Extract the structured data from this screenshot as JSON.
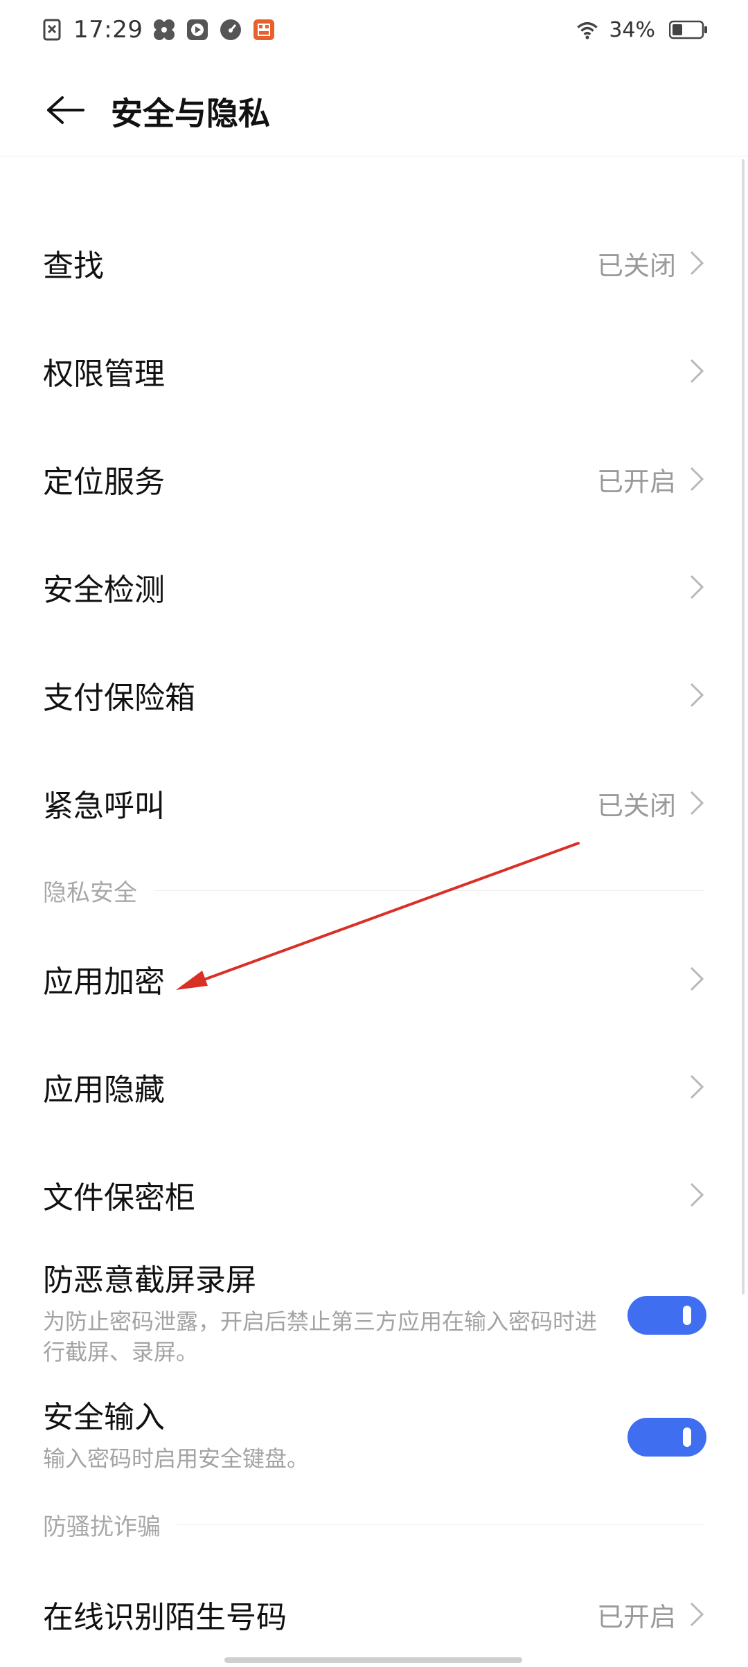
{
  "status_bar": {
    "time": "17:29",
    "battery_percent": "34%",
    "battery_level": 0.34,
    "icons": [
      "notification-off-icon",
      "pinwheel-icon",
      "video-icon",
      "speedometer-icon",
      "app-notification-icon",
      "wifi-icon",
      "battery-icon"
    ]
  },
  "header": {
    "title": "安全与隐私",
    "back_icon": "back-arrow-icon"
  },
  "sections": {
    "main": {
      "items": [
        {
          "label": "查找",
          "value": "已关闭"
        },
        {
          "label": "权限管理",
          "value": ""
        },
        {
          "label": "定位服务",
          "value": "已开启"
        },
        {
          "label": "安全检测",
          "value": ""
        },
        {
          "label": "支付保险箱",
          "value": ""
        },
        {
          "label": "紧急呼叫",
          "value": "已关闭"
        }
      ]
    },
    "privacy": {
      "title": "隐私安全",
      "items": [
        {
          "label": "应用加密",
          "value": ""
        },
        {
          "label": "应用隐藏",
          "value": ""
        },
        {
          "label": "文件保密柜",
          "value": ""
        }
      ],
      "toggles": [
        {
          "title": "防恶意截屏录屏",
          "description": "为防止密码泄露，开启后禁止第三方应用在输入密码时进行截屏、录屏。",
          "enabled": true
        },
        {
          "title": "安全输入",
          "description": "输入密码时启用安全键盘。",
          "enabled": true
        }
      ]
    },
    "anti_fraud": {
      "title": "防骚扰诈骗",
      "items": [
        {
          "label": "在线识别陌生号码",
          "value": "已开启"
        }
      ]
    }
  },
  "colors": {
    "accent": "#3F6EF0",
    "secondary_text": "#9A9A9A",
    "annotation": "#D93025"
  }
}
